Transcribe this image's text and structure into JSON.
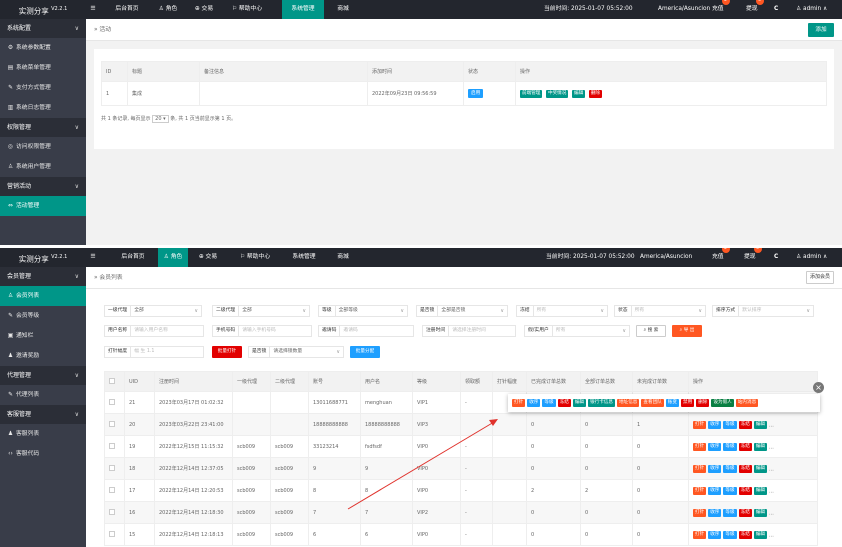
{
  "brand": {
    "name": "实测分享",
    "version": "V2.2.1"
  },
  "topbar": {
    "nav": [
      "后台首页",
      "角色",
      "交易",
      "帮助中心",
      "系统管理",
      "商城"
    ],
    "time_label": "当前时间: 2025-01-07 05:52:00",
    "timezone": "America/Asuncion",
    "recharge": "充值",
    "recharge_badge": "2",
    "withdraw": "提现",
    "withdraw_badge": "0",
    "refresh": "C",
    "user": "admin"
  },
  "sidebar1": {
    "groups": [
      {
        "label": "系统配置",
        "items": [
          "系统参数配置",
          "系统菜单管理",
          "支付方式管理",
          "系统日志管理"
        ]
      },
      {
        "label": "权限管理",
        "items": [
          "访问权限管理",
          "系统用户管理"
        ]
      },
      {
        "label": "营销活动",
        "items": [
          "活动管理"
        ]
      }
    ]
  },
  "activity": {
    "breadcrumb": "活动",
    "add_button": "添加",
    "columns": [
      "ID",
      "标题",
      "备注信息",
      "添加时间",
      "状态",
      "操作"
    ],
    "rows": [
      {
        "id": "1",
        "title": "集成",
        "remark": "",
        "time": "2022年09月23日 09:56:59",
        "status": "启用",
        "ops": [
          "前端管理",
          "中奖情况",
          "编辑",
          "删除"
        ]
      }
    ],
    "pager": {
      "prefix": "共 1 条记录, 每页显示",
      "size": "20",
      "suffix": "条, 共 1 页当前显示第 1 页。"
    }
  },
  "sidebar2": {
    "groups": [
      {
        "label": "会员管理",
        "items": [
          "会员列表",
          "会员等级",
          "通知栏",
          "邀请奖励"
        ]
      },
      {
        "label": "代理管理",
        "items": [
          "代理列表"
        ]
      },
      {
        "label": "客服管理",
        "items": [
          "客服列表",
          "客服代码"
        ]
      }
    ]
  },
  "members": {
    "breadcrumb": "会员列表",
    "add_button": "添加会员",
    "filters": {
      "level1": {
        "label": "一级代理",
        "value": "全部"
      },
      "level2": {
        "label": "二级代理",
        "value": "全部"
      },
      "rank": {
        "label": "等级",
        "value": "全部等级"
      },
      "lock": {
        "label": "是否锁",
        "value": "全部是否锁"
      },
      "freeze": {
        "label": "冻结",
        "value": "所有"
      },
      "status": {
        "label": "状态",
        "value": "所有"
      },
      "sort": {
        "label": "排序方式",
        "value": "默认排序"
      },
      "nickname": {
        "label": "用户名称",
        "placeholder": "请输入用户名称"
      },
      "phone": {
        "label": "手机号码",
        "placeholder": "请输入手机号码"
      },
      "invite": {
        "label": "邀请码",
        "placeholder": "邀请码"
      },
      "regtime": {
        "label": "注册时间",
        "placeholder": "请选择注册时间"
      },
      "fake": {
        "label": "假/实用户",
        "value": "所有"
      },
      "search": "搜 索",
      "export": "导 出",
      "print_amount": {
        "label": "打针幅度",
        "placeholder": "幅 生 1.1"
      },
      "batch_print": "批量打针",
      "batch_sel": {
        "label": "是否锁",
        "value": "请选择锁数量"
      },
      "batch_assign": "批量分配"
    },
    "columns": [
      "",
      "UID",
      "注册时间",
      "一级代理",
      "二级代理",
      "账号",
      "用户名",
      "等级",
      "领取额",
      "打针幅度",
      "已完成订单总数",
      "全部订单总数",
      "未完成订单数",
      "操作"
    ],
    "rows": [
      {
        "uid": "21",
        "time": "2023年03月17日 01:02:32",
        "l1": "",
        "l2": "",
        "acc": "13011688771",
        "name": "menghuan",
        "vip": "VIP1",
        "amt": "-",
        "rate": "",
        "done": "",
        "all": "",
        "undone": ""
      },
      {
        "uid": "20",
        "time": "2023年03月22日 23:41:00",
        "l1": "",
        "l2": "",
        "acc": "18888888888",
        "name": "18888888888",
        "vip": "VIP3",
        "amt": "",
        "rate": "",
        "done": "0",
        "all": "0",
        "undone": "1"
      },
      {
        "uid": "19",
        "time": "2022年12月15日 11:15:32",
        "l1": "scb009",
        "l2": "scb009",
        "acc": "33123214",
        "name": "fsdfsdf",
        "vip": "VIP0",
        "amt": "-",
        "rate": "",
        "done": "0",
        "all": "0",
        "undone": "0"
      },
      {
        "uid": "18",
        "time": "2022年12月14日 12:37:05",
        "l1": "scb009",
        "l2": "scb009",
        "acc": "9",
        "name": "9",
        "vip": "VIP0",
        "amt": "-",
        "rate": "",
        "done": "0",
        "all": "0",
        "undone": "0"
      },
      {
        "uid": "17",
        "time": "2022年12月14日 12:20:53",
        "l1": "scb009",
        "l2": "scb009",
        "acc": "8",
        "name": "8",
        "vip": "VIP0",
        "amt": "-",
        "rate": "",
        "done": "2",
        "all": "2",
        "undone": "0"
      },
      {
        "uid": "16",
        "time": "2022年12月14日 12:18:30",
        "l1": "scb009",
        "l2": "scb009",
        "acc": "7",
        "name": "7",
        "vip": "VIP2",
        "amt": "-",
        "rate": "",
        "done": "0",
        "all": "0",
        "undone": "0"
      },
      {
        "uid": "15",
        "time": "2022年12月14日 12:18:13",
        "l1": "scb009",
        "l2": "scb009",
        "acc": "6",
        "name": "6",
        "vip": "VIP0",
        "amt": "-",
        "rate": "",
        "done": "0",
        "all": "0",
        "undone": "0"
      }
    ],
    "row_ops": [
      "打针",
      "收序",
      "等级",
      "冻结",
      "编辑"
    ],
    "popover_ops": [
      "打针",
      "收序",
      "等级",
      "冻结",
      "编辑",
      "银行卡信息",
      "地址信息",
      "查看团队",
      "账变",
      "禁用",
      "删除",
      "设为假人",
      "站内消息"
    ],
    "popover_close": "×",
    "more": "..."
  }
}
